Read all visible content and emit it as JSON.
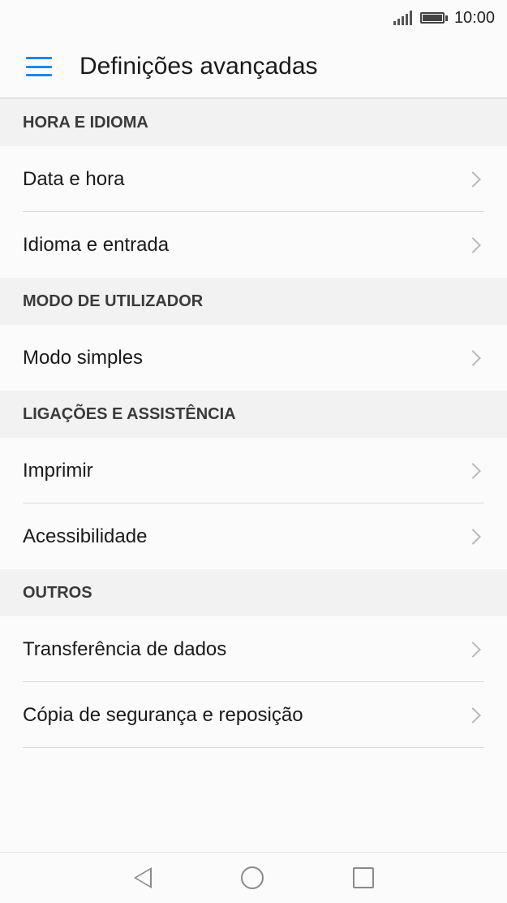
{
  "status_bar": {
    "time": "10:00"
  },
  "app_bar": {
    "title": "Definições avançadas"
  },
  "sections": [
    {
      "header": "HORA E IDIOMA",
      "items": [
        "Data e hora",
        "Idioma e entrada"
      ]
    },
    {
      "header": "MODO DE UTILIZADOR",
      "items": [
        "Modo simples"
      ]
    },
    {
      "header": "LIGAÇÕES E ASSISTÊNCIA",
      "items": [
        "Imprimir",
        "Acessibilidade"
      ]
    },
    {
      "header": "OUTROS",
      "items": [
        "Transferência de dados",
        "Cópia de segurança e reposição"
      ]
    }
  ],
  "icons": {
    "menu": "hamburger-menu-icon",
    "chevron": "chevron-right-icon",
    "signal": "signal-icon",
    "battery": "battery-icon",
    "nav_back": "back-triangle-icon",
    "nav_home": "home-circle-icon",
    "nav_recent": "recent-square-icon"
  },
  "colors": {
    "accent": "#1e88e5",
    "section_bg": "#f2f2f2",
    "background": "#fbfbfb"
  }
}
